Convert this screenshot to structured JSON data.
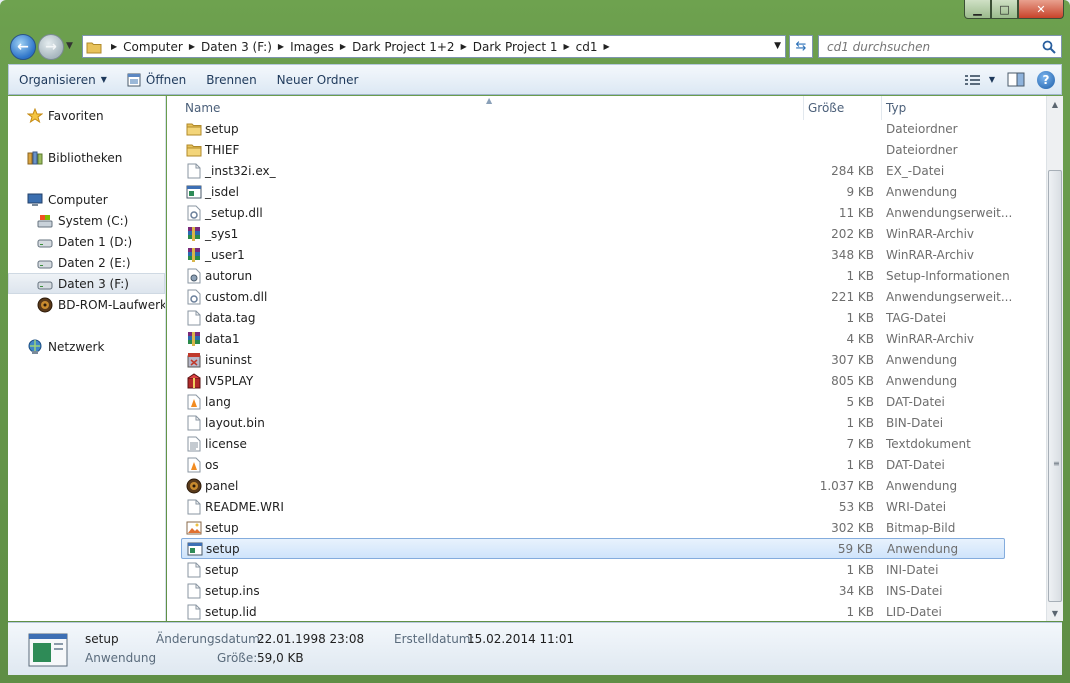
{
  "window": {
    "controls": {
      "minimize": "▁",
      "maximize": "□",
      "close": "✕"
    }
  },
  "address": {
    "crumbs": [
      "Computer",
      "Daten 3 (F:)",
      "Images",
      "Dark Project 1+2",
      "Dark Project 1",
      "cd1"
    ],
    "search_placeholder": "cd1 durchsuchen"
  },
  "toolbar": {
    "organize": "Organisieren",
    "open": "Öffnen",
    "burn": "Brennen",
    "new_folder": "Neuer Ordner"
  },
  "nav": {
    "favorites": "Favoriten",
    "libraries": "Bibliotheken",
    "computer": "Computer",
    "drives": [
      "System (C:)",
      "Daten 1 (D:)",
      "Daten 2 (E:)",
      "Daten 3 (F:)",
      "BD-ROM-Laufwerk ("
    ],
    "network": "Netzwerk"
  },
  "columns": {
    "name": "Name",
    "size": "Größe",
    "type": "Typ"
  },
  "files": [
    {
      "name": "setup",
      "size": "",
      "type": "Dateiordner",
      "icon": "folder"
    },
    {
      "name": "THIEF",
      "size": "",
      "type": "Dateiordner",
      "icon": "folder"
    },
    {
      "name": "_inst32i.ex_",
      "size": "284 KB",
      "type": "EX_-Datei",
      "icon": "blank"
    },
    {
      "name": "_isdel",
      "size": "9 KB",
      "type": "Anwendung",
      "icon": "app"
    },
    {
      "name": "_setup.dll",
      "size": "11 KB",
      "type": "Anwendungserweit...",
      "icon": "dll"
    },
    {
      "name": "_sys1",
      "size": "202 KB",
      "type": "WinRAR-Archiv",
      "icon": "rar"
    },
    {
      "name": "_user1",
      "size": "348 KB",
      "type": "WinRAR-Archiv",
      "icon": "rar"
    },
    {
      "name": "autorun",
      "size": "1 KB",
      "type": "Setup-Informationen",
      "icon": "inf"
    },
    {
      "name": "custom.dll",
      "size": "221 KB",
      "type": "Anwendungserweit...",
      "icon": "dll"
    },
    {
      "name": "data.tag",
      "size": "1 KB",
      "type": "TAG-Datei",
      "icon": "blank"
    },
    {
      "name": "data1",
      "size": "4 KB",
      "type": "WinRAR-Archiv",
      "icon": "rar"
    },
    {
      "name": "isuninst",
      "size": "307 KB",
      "type": "Anwendung",
      "icon": "uninst"
    },
    {
      "name": "IV5PLAY",
      "size": "805 KB",
      "type": "Anwendung",
      "icon": "box"
    },
    {
      "name": "lang",
      "size": "5 KB",
      "type": "DAT-Datei",
      "icon": "vlc"
    },
    {
      "name": "layout.bin",
      "size": "1 KB",
      "type": "BIN-Datei",
      "icon": "blank"
    },
    {
      "name": "license",
      "size": "7 KB",
      "type": "Textdokument",
      "icon": "text"
    },
    {
      "name": "os",
      "size": "1 KB",
      "type": "DAT-Datei",
      "icon": "vlc"
    },
    {
      "name": "panel",
      "size": "1.037 KB",
      "type": "Anwendung",
      "icon": "disc"
    },
    {
      "name": "README.WRI",
      "size": "53 KB",
      "type": "WRI-Datei",
      "icon": "blank"
    },
    {
      "name": "setup",
      "size": "302 KB",
      "type": "Bitmap-Bild",
      "icon": "bmp"
    },
    {
      "name": "setup",
      "size": "59 KB",
      "type": "Anwendung",
      "icon": "app",
      "selected": true
    },
    {
      "name": "setup",
      "size": "1 KB",
      "type": "INI-Datei",
      "icon": "blank"
    },
    {
      "name": "setup.ins",
      "size": "34 KB",
      "type": "INS-Datei",
      "icon": "blank"
    },
    {
      "name": "setup.lid",
      "size": "1 KB",
      "type": "LID-Datei",
      "icon": "blank"
    }
  ],
  "details": {
    "name": "setup",
    "type": "Anwendung",
    "modified_label": "Änderungsdatum:",
    "modified": "22.01.1998 23:08",
    "created_label": "Erstelldatum:",
    "created": "15.02.2014 11:01",
    "size_label": "Größe:",
    "size": "59,0 KB"
  }
}
